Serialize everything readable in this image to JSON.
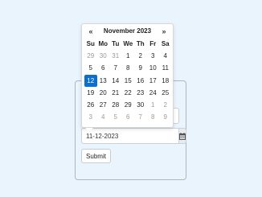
{
  "form": {
    "date_value": "11-12-2023",
    "submit_label": "Submit"
  },
  "icons": {
    "calendar": "calendar-icon"
  },
  "datepicker": {
    "prev_label": "«",
    "next_label": "»",
    "month_title": "November 2023",
    "weekdays": [
      "Su",
      "Mo",
      "Tu",
      "We",
      "Th",
      "Fr",
      "Sa"
    ],
    "weeks": [
      [
        {
          "d": "29",
          "m": true
        },
        {
          "d": "30",
          "m": true
        },
        {
          "d": "31",
          "m": true
        },
        {
          "d": "1"
        },
        {
          "d": "2"
        },
        {
          "d": "3"
        },
        {
          "d": "4"
        }
      ],
      [
        {
          "d": "5"
        },
        {
          "d": "6"
        },
        {
          "d": "7"
        },
        {
          "d": "8"
        },
        {
          "d": "9"
        },
        {
          "d": "10"
        },
        {
          "d": "11"
        }
      ],
      [
        {
          "d": "12",
          "a": true
        },
        {
          "d": "13"
        },
        {
          "d": "14"
        },
        {
          "d": "15"
        },
        {
          "d": "16"
        },
        {
          "d": "17"
        },
        {
          "d": "18"
        }
      ],
      [
        {
          "d": "19"
        },
        {
          "d": "20"
        },
        {
          "d": "21"
        },
        {
          "d": "22"
        },
        {
          "d": "23"
        },
        {
          "d": "24"
        },
        {
          "d": "25"
        }
      ],
      [
        {
          "d": "26"
        },
        {
          "d": "27"
        },
        {
          "d": "28"
        },
        {
          "d": "29"
        },
        {
          "d": "30"
        },
        {
          "d": "1",
          "m": true
        },
        {
          "d": "2",
          "m": true
        }
      ],
      [
        {
          "d": "3",
          "m": true
        },
        {
          "d": "4",
          "m": true
        },
        {
          "d": "5",
          "m": true
        },
        {
          "d": "6",
          "m": true
        },
        {
          "d": "7",
          "m": true
        },
        {
          "d": "8",
          "m": true
        },
        {
          "d": "9",
          "m": true
        }
      ]
    ]
  },
  "colors": {
    "page_bg": "#e9f4fd",
    "active_day": "#0b6fd2",
    "muted_day": "#9a9a9a"
  }
}
